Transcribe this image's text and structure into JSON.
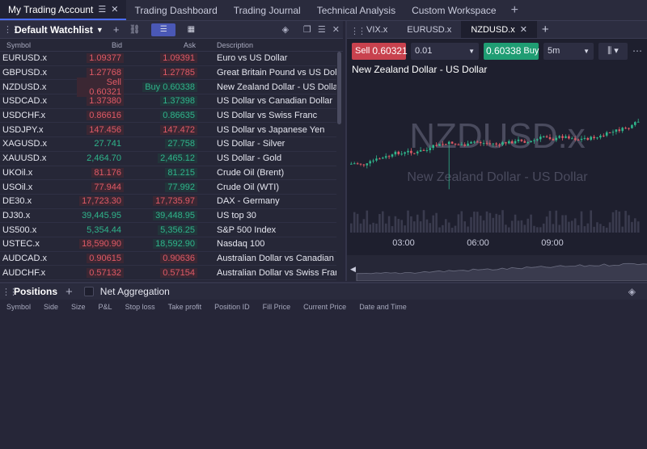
{
  "workspace_tabs": [
    {
      "label": "My Trading Account",
      "active": true
    },
    {
      "label": "Trading Dashboard"
    },
    {
      "label": "Trading Journal"
    },
    {
      "label": "Technical Analysis"
    },
    {
      "label": "Custom Workspace"
    }
  ],
  "watchlist": {
    "title": "Default Watchlist",
    "columns": {
      "symbol": "Symbol",
      "bid": "Bid",
      "ask": "Ask",
      "description": "Description"
    },
    "rows": [
      {
        "symbol": "EURUSD.x",
        "bid": "1.09377",
        "ask": "1.09391",
        "desc": "Euro vs US Dollar"
      },
      {
        "symbol": "GBPUSD.x",
        "bid": "1.27768",
        "ask": "1.27785",
        "desc": "Great Britain Pound vs US Dollar"
      },
      {
        "symbol": "NZDUSD.x",
        "bid": "0.60321",
        "ask": "0.60338",
        "desc": "New Zealand Dollar - US Dollar",
        "bid_prefix": "Sell",
        "ask_prefix": "Buy"
      },
      {
        "symbol": "USDCAD.x",
        "bid": "1.37380",
        "ask": "1.37398",
        "desc": "US Dollar vs Canadian Dollar"
      },
      {
        "symbol": "USDCHF.x",
        "bid": "0.86616",
        "ask": "0.86635",
        "desc": "US Dollar vs Swiss Franc"
      },
      {
        "symbol": "USDJPY.x",
        "bid": "147.456",
        "ask": "147.472",
        "desc": "US Dollar vs Japanese Yen"
      },
      {
        "symbol": "XAGUSD.x",
        "bid": "27.741",
        "ask": "27.758",
        "desc": "US Dollar - Silver"
      },
      {
        "symbol": "XAUUSD.x",
        "bid": "2,464.70",
        "ask": "2,465.12",
        "desc": "US Dollar - Gold"
      },
      {
        "symbol": "UKOil.x",
        "bid": "81.176",
        "ask": "81.215",
        "desc": "Crude Oil (Brent)"
      },
      {
        "symbol": "USOil.x",
        "bid": "77.944",
        "ask": "77.992",
        "desc": "Crude Oil (WTI)"
      },
      {
        "symbol": "DE30.x",
        "bid": "17,723.30",
        "ask": "17,735.97",
        "desc": "DAX - Germany"
      },
      {
        "symbol": "DJ30.x",
        "bid": "39,445.95",
        "ask": "39,448.95",
        "desc": "US top 30"
      },
      {
        "symbol": "US500.x",
        "bid": "5,354.44",
        "ask": "5,356.25",
        "desc": "S&P 500 Index"
      },
      {
        "symbol": "USTEC.x",
        "bid": "18,590.90",
        "ask": "18,592.90",
        "desc": "Nasdaq 100"
      },
      {
        "symbol": "AUDCAD.x",
        "bid": "0.90615",
        "ask": "0.90636",
        "desc": "Australian Dollar vs Canadian Do"
      },
      {
        "symbol": "AUDCHF.x",
        "bid": "0.57132",
        "ask": "0.57154",
        "desc": "Australian Dollar vs Swiss Franc"
      }
    ]
  },
  "chart_tabs": [
    {
      "label": "VIX.x"
    },
    {
      "label": "EURUSD.x"
    },
    {
      "label": "NZDUSD.x",
      "active": true
    }
  ],
  "trade": {
    "sell_label": "Sell",
    "sell_price": "0.60321",
    "quantity": "0.01",
    "buy_label": "Buy",
    "buy_price": "0.60338",
    "timeframe": "5m"
  },
  "chart": {
    "title": "New Zealand Dollar - US Dollar",
    "watermark_symbol": "NZDUSD.x",
    "watermark_desc": "New Zealand Dollar - US Dollar",
    "time_labels": [
      "03:00",
      "06:00",
      "09:00"
    ]
  },
  "positions": {
    "tab_label": "Positions",
    "aggregation_label": "Net Aggregation",
    "columns": [
      "Symbol",
      "Side",
      "Size",
      "P&L",
      "Stop loss",
      "Take profit",
      "Position ID",
      "Fill Price",
      "Current Price",
      "Date and Time"
    ]
  },
  "colors": {
    "sell": "#c8424e",
    "buy": "#1f9d73",
    "accent": "#4a58b6"
  }
}
